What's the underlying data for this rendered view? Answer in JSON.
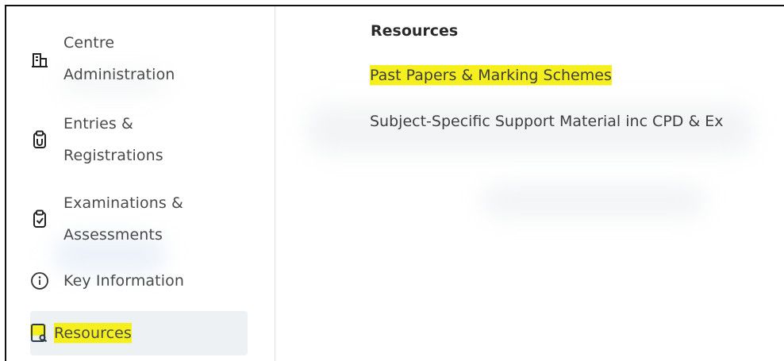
{
  "sidebar": {
    "items": [
      {
        "label_line1": "Centre",
        "label_line2": "Administration",
        "icon": "building-icon"
      },
      {
        "label_line1": "Entries &",
        "label_line2": "Registrations",
        "icon": "clipboard-entries-icon"
      },
      {
        "label_line1": "Examinations &",
        "label_line2": "Assessments",
        "icon": "clipboard-check-icon"
      },
      {
        "label": "Key Information",
        "icon": "info-icon"
      },
      {
        "label": "Resources",
        "icon": "document-search-icon"
      }
    ]
  },
  "main": {
    "heading": "Resources",
    "links": [
      {
        "label": "Past Papers & Marking Schemes"
      },
      {
        "label": "Subject-Specific Support Material inc CPD & Ex"
      }
    ]
  },
  "colors": {
    "highlight": "#f5ef1d",
    "active_bg": "#eef1f3",
    "divider": "#d9e0e4"
  }
}
